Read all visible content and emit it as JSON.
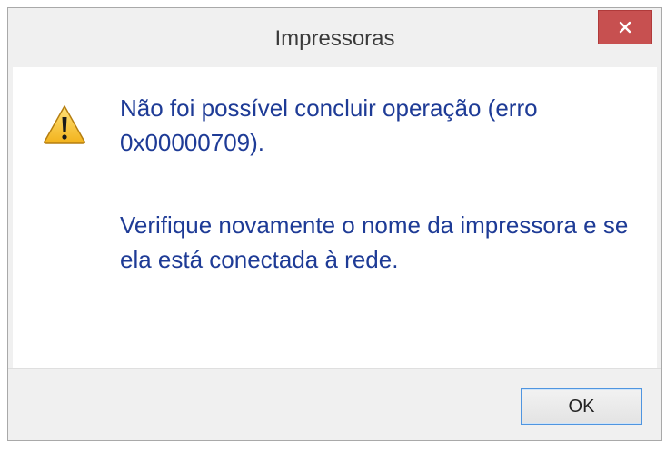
{
  "dialog": {
    "title": "Impressoras",
    "message_line1": "Não foi possível concluir operação (erro 0x00000709).",
    "message_line2": "Verifique novamente o nome da impressora e se ela está conectada à rede.",
    "ok_label": "OK",
    "icon": "warning-icon",
    "colors": {
      "message_text": "#1e3b96",
      "close_button": "#c75050",
      "ok_border": "#4f95e0"
    }
  }
}
